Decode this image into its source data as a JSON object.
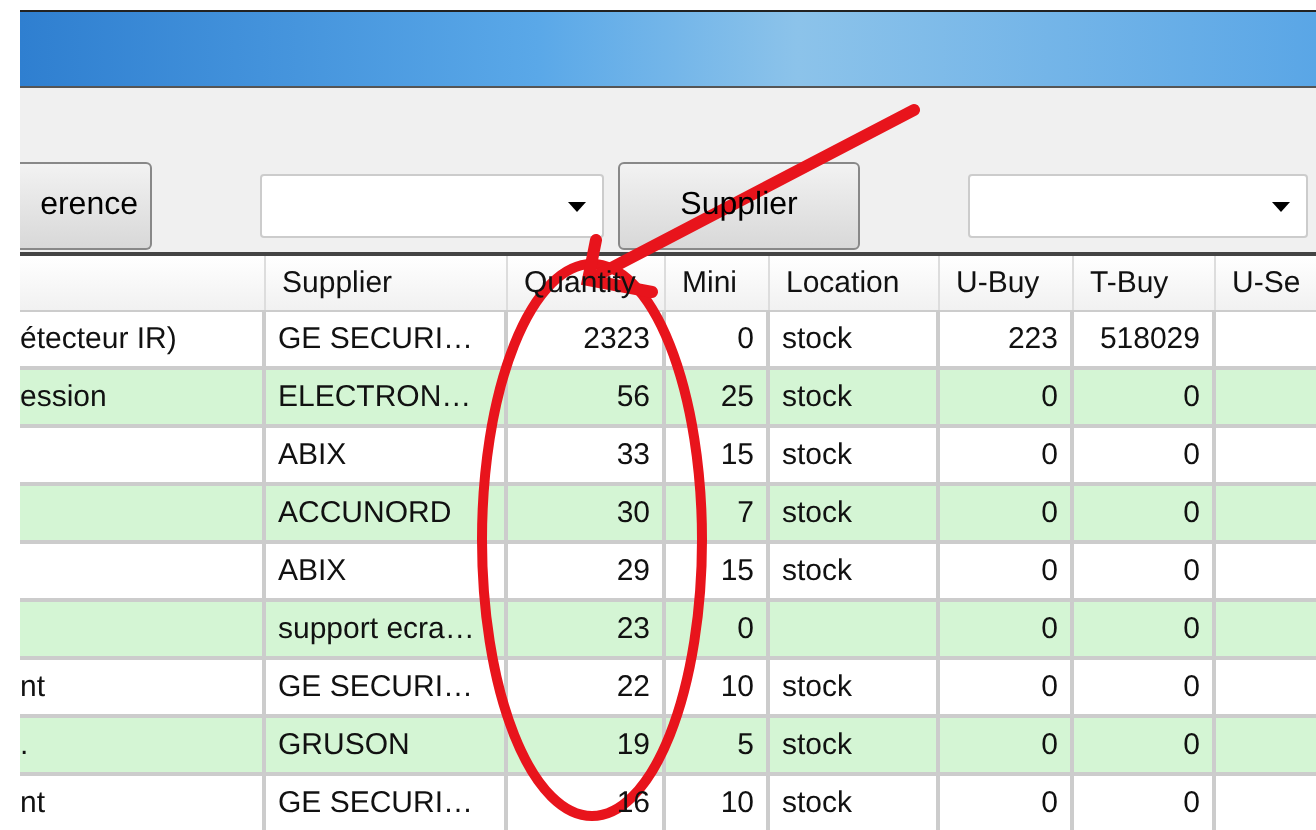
{
  "toolbar": {
    "items": [
      {
        "kind": "button",
        "label": "erence"
      },
      {
        "kind": "combo"
      },
      {
        "kind": "button",
        "label": "Supplier"
      },
      {
        "kind": "combo"
      }
    ]
  },
  "table": {
    "columns": [
      "Supplier",
      "Quantity",
      "Mini",
      "Location",
      "U-Buy",
      "T-Buy",
      "U-Se"
    ],
    "rows": [
      {
        "column_1": "étecteur IR)",
        "supplier": "GE SECURI…",
        "quantity": "2323",
        "mini": "0",
        "location": "stock",
        "u_buy": "223",
        "t_buy": "518029"
      },
      {
        "column_1": "ession",
        "supplier": "ELECTRON…",
        "quantity": "56",
        "mini": "25",
        "location": "stock",
        "u_buy": "0",
        "t_buy": "0"
      },
      {
        "supplier": "ABIX",
        "quantity": "33",
        "mini": "15",
        "location": "stock",
        "u_buy": "0",
        "t_buy": "0"
      },
      {
        "supplier": "ACCUNORD",
        "quantity": "30",
        "mini": "7",
        "location": "stock",
        "u_buy": "0",
        "t_buy": "0"
      },
      {
        "supplier": "ABIX",
        "quantity": "29",
        "mini": "15",
        "location": "stock",
        "u_buy": "0",
        "t_buy": "0"
      },
      {
        "supplier": "support ecra…",
        "quantity": "23",
        "mini": "0",
        "u_buy": "0",
        "t_buy": "0"
      },
      {
        "column_1": "nt",
        "supplier": "GE SECURI…",
        "quantity": "22",
        "mini": "10",
        "location": "stock",
        "u_buy": "0",
        "t_buy": "0"
      },
      {
        "column_1": ".",
        "supplier": "GRUSON",
        "quantity": "19",
        "mini": "5",
        "location": "stock",
        "u_buy": "0",
        "t_buy": "0"
      },
      {
        "column_1": "nt",
        "supplier": "GE SECURI…",
        "quantity": "16",
        "mini": "10",
        "location": "stock",
        "u_buy": "0",
        "t_buy": "0"
      }
    ]
  }
}
